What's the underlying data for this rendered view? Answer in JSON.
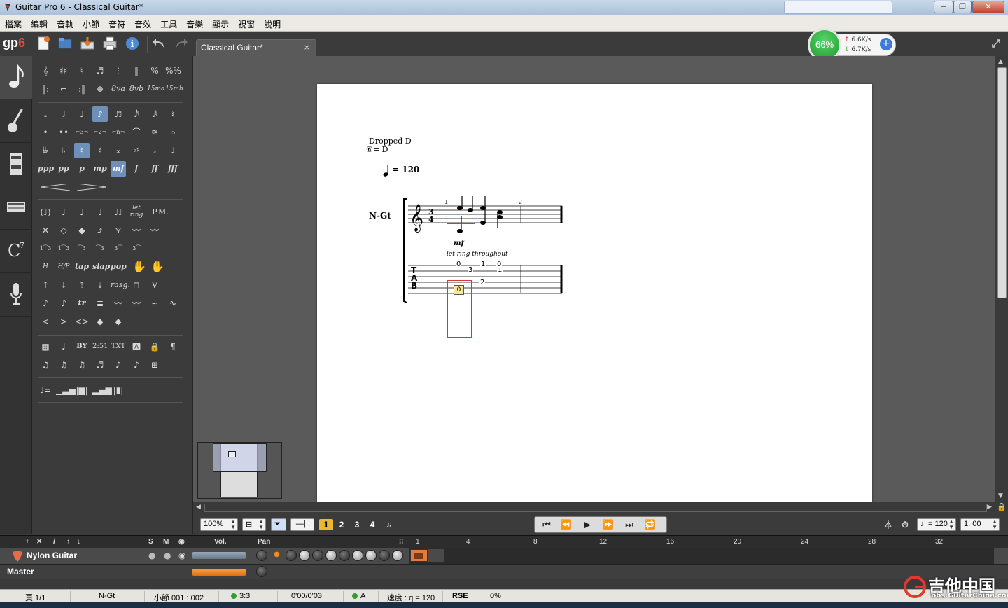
{
  "window": {
    "title": "Guitar Pro 6 - Classical Guitar*",
    "controls": [
      "minimize",
      "maximize",
      "close"
    ]
  },
  "menu": {
    "items": [
      "檔案",
      "編輯",
      "音軌",
      "小節",
      "音符",
      "音效",
      "工具",
      "音樂",
      "顯示",
      "視窗",
      "說明"
    ]
  },
  "toolbar": {
    "logo_prefix": "gp",
    "logo_version": "6",
    "icons": [
      "new-file-icon",
      "open-file-icon",
      "save-icon",
      "print-icon",
      "info-icon",
      "undo-icon",
      "redo-icon"
    ]
  },
  "document_tab": {
    "label": "Classical Guitar*",
    "close": "×"
  },
  "net_monitor": {
    "percent": "66%",
    "upload": "6.6K/s",
    "download": "6.7K/s"
  },
  "left_tabs": [
    "notes-icon",
    "guitar-icon",
    "effects-icon",
    "keyboard-icon",
    "chord-icon",
    "microphone-icon"
  ],
  "palette": {
    "notation_symbols": [
      "8va",
      "8vb",
      "15ma",
      "15mb"
    ],
    "dynamics": [
      "ppp",
      "pp",
      "p",
      "mp",
      "mf",
      "f",
      "ff",
      "fff"
    ],
    "active_dynamic": "mf",
    "techniques_text": [
      "let ring",
      "P.M.",
      "tap",
      "slap",
      "pop",
      "rasg.",
      "tr"
    ],
    "other_text": [
      "BY",
      "2:51",
      "TXT"
    ]
  },
  "score": {
    "tuning_name": "Dropped D",
    "tuning_note": "⑥= D",
    "tempo": "= 120",
    "track_name": "N-Gt",
    "time_signature": "3/4",
    "bar_numbers": [
      "1",
      "2"
    ],
    "dynamic": "mf",
    "annotation": "let ring throughout",
    "tab_letters": [
      "T",
      "A",
      "B"
    ],
    "tab_frets": [
      {
        "string": 1,
        "value": "0"
      },
      {
        "string": 2,
        "value": "3"
      },
      {
        "string": 1,
        "value": "1"
      },
      {
        "string": 2,
        "value": "1"
      },
      {
        "string": 1,
        "value": "0"
      },
      {
        "string": 4,
        "value": "2"
      }
    ],
    "selected_fret": "0"
  },
  "bottom_toolbar": {
    "zoom": "100%",
    "voices": [
      "1",
      "2",
      "3",
      "4"
    ],
    "active_voice": "1",
    "tempo_field": "♩= 120",
    "speed_field": "1. 00"
  },
  "mixer": {
    "header": {
      "solo": "S",
      "mute": "M",
      "volume": "Vol.",
      "pan": "Pan"
    },
    "track": "Nylon Guitar",
    "master": "Master",
    "timeline_marks": [
      "1",
      "4",
      "8",
      "12",
      "16",
      "20",
      "24",
      "28",
      "32"
    ]
  },
  "status_bar": {
    "page": "頁 1/1",
    "track": "N-Gt",
    "bar": "小節 001 : 002",
    "signature": "3:3",
    "time": "0'00/0'03",
    "key": "A",
    "tempo": "速度 : q = 120",
    "rse": "RSE",
    "cpu": "0%"
  },
  "watermark": {
    "text": "吉他中国",
    "url": "bbs.GuitarChina.com"
  },
  "colors": {
    "accent_active": "#6d8fb8",
    "voice_active": "#e8b830",
    "selection_red": "#dd3333",
    "track_color": "#e57a3b"
  }
}
